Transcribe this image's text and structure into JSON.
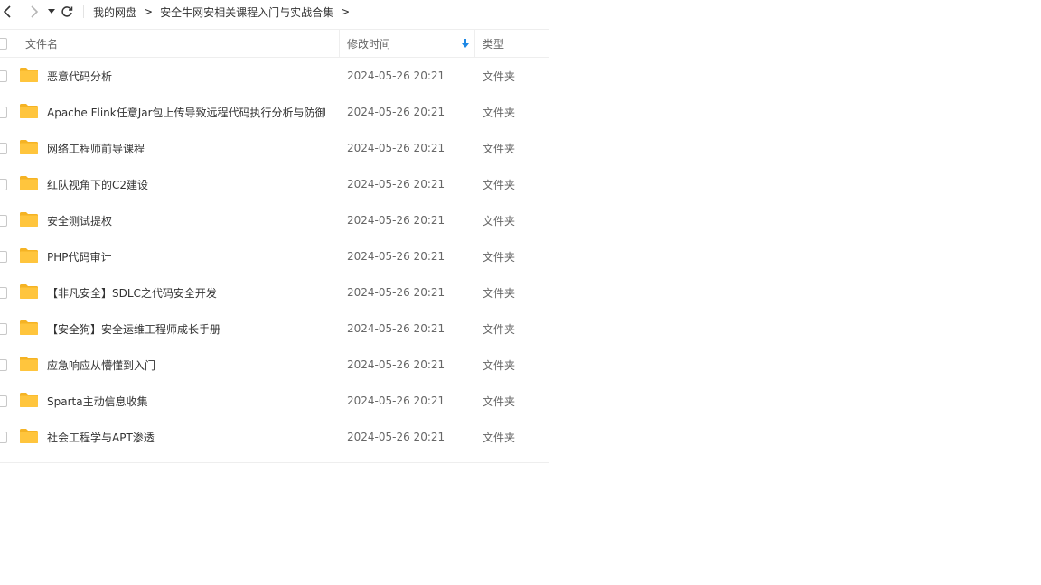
{
  "breadcrumb": {
    "items": [
      "我的网盘",
      "安全牛网安相关课程入门与实战合集"
    ],
    "separator": ">"
  },
  "header": {
    "name": "文件名",
    "time": "修改时间",
    "type": "类型"
  },
  "rows": [
    {
      "name": "恶意代码分析",
      "time": "2024-05-26 20:21",
      "type": "文件夹"
    },
    {
      "name": "Apache Flink任意Jar包上传导致远程代码执行分析与防御",
      "time": "2024-05-26 20:21",
      "type": "文件夹"
    },
    {
      "name": "网络工程师前导课程",
      "time": "2024-05-26 20:21",
      "type": "文件夹"
    },
    {
      "name": "红队视角下的C2建设",
      "time": "2024-05-26 20:21",
      "type": "文件夹"
    },
    {
      "name": "安全测试提权",
      "time": "2024-05-26 20:21",
      "type": "文件夹"
    },
    {
      "name": "PHP代码审计",
      "time": "2024-05-26 20:21",
      "type": "文件夹"
    },
    {
      "name": "【非凡安全】SDLC之代码安全开发",
      "time": "2024-05-26 20:21",
      "type": "文件夹"
    },
    {
      "name": "【安全狗】安全运维工程师成长手册",
      "time": "2024-05-26 20:21",
      "type": "文件夹"
    },
    {
      "name": "应急响应从懵懂到入门",
      "time": "2024-05-26 20:21",
      "type": "文件夹"
    },
    {
      "name": "Sparta主动信息收集",
      "time": "2024-05-26 20:21",
      "type": "文件夹"
    },
    {
      "name": "社会工程学与APT渗透",
      "time": "2024-05-26 20:21",
      "type": "文件夹"
    }
  ],
  "colors": {
    "folder": "#ffc53d",
    "folder_back": "#f5b324",
    "sort_arrow": "#1e88e5",
    "divider": "#eeeeee"
  }
}
